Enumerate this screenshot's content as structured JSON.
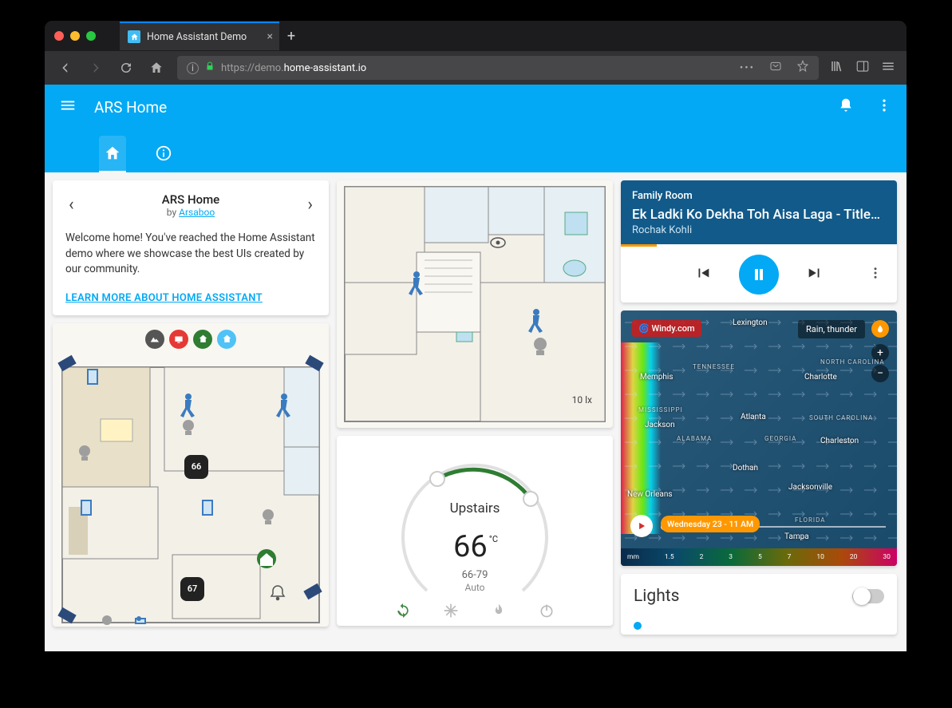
{
  "browser": {
    "tab_title": "Home Assistant Demo",
    "url_prefix": "https://demo.",
    "url_bold": "home-assistant.io",
    "url_suffix": ""
  },
  "header": {
    "title": "ARS Home"
  },
  "welcome": {
    "title": "ARS Home",
    "by_prefix": "by ",
    "author": "Arsaboo",
    "body": "Welcome home! You've reached the Home Assistant demo where we showcase the best UIs created by our community.",
    "link": "LEARN MORE ABOUT HOME ASSISTANT"
  },
  "floorplan_main": {
    "temp1": "66",
    "temp2": "67"
  },
  "floorplan_upper": {
    "lux": "10 lx"
  },
  "thermostat": {
    "name": "Upstairs",
    "temp": "66",
    "unit": "°C",
    "range": "66-79",
    "mode": "Auto"
  },
  "media": {
    "room": "Family Room",
    "title": "Ek Ladki Ko Dekha Toh Aisa Laga - Title…",
    "artist": "Rochak Kohli",
    "progress_pct": 13
  },
  "weather": {
    "provider": "Windy.com",
    "layer": "Rain, thunder",
    "timestamp": "Wednesday 23 - 11 AM",
    "cities": [
      "Lexington",
      "Memphis",
      "Charlotte",
      "Atlanta",
      "Jackson",
      "Charleston",
      "Dothan",
      "New Orleans",
      "Jacksonville",
      "Tampa"
    ],
    "states": [
      "TENNESSEE",
      "NORTH CAROLINA",
      "ALABAMA",
      "GEORGIA",
      "SOUTH CAROLINA",
      "MISSISSIPPI",
      "FLORIDA"
    ],
    "legend_unit": "mm",
    "legend": [
      "1.5",
      "2",
      "3",
      "5",
      "7",
      "10",
      "20",
      "30"
    ]
  },
  "lights": {
    "title": "Lights"
  }
}
